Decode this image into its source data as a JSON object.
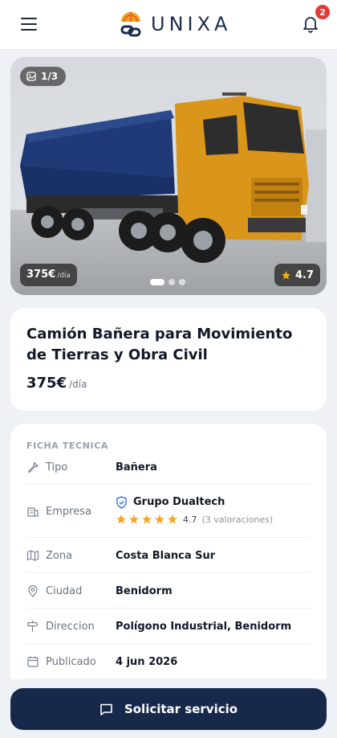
{
  "header": {
    "brand": "UNIXA",
    "notification_count": "2"
  },
  "hero": {
    "image_counter": "1/3",
    "price": "375€",
    "price_unit": "/día",
    "rating": "4.7",
    "slides_total": 3,
    "active_slide": 1
  },
  "listing": {
    "title": "Camión Bañera para Movimiento de Tierras y Obra Civil",
    "price": "375€",
    "price_unit": "/día"
  },
  "spec": {
    "heading": "FICHA TECNICA",
    "tipo": {
      "label": "Tipo",
      "value": "Bañera"
    },
    "empresa": {
      "label": "Empresa",
      "name": "Grupo Dualtech",
      "rating": "4.7",
      "stars": 5,
      "reviews": "(3 valoraciones)"
    },
    "zona": {
      "label": "Zona",
      "value": "Costa Blanca Sur"
    },
    "ciudad": {
      "label": "Ciudad",
      "value": "Benidorm"
    },
    "direccion": {
      "label": "Direccion",
      "value": "Polígono Industrial, Benidorm"
    },
    "publicado": {
      "label": "Publicado",
      "value": "4 jun 2026"
    }
  },
  "cta": {
    "label": "Solicitar servicio"
  },
  "icons": {
    "menu": "hamburger-icon",
    "bell": "bell-icon",
    "image": "image-icon",
    "star": "star-icon",
    "tipo": "wrench-icon",
    "empresa": "building-icon",
    "verified": "shield-check-icon",
    "zona": "map-icon",
    "ciudad": "location-pin-icon",
    "direccion": "signpost-icon",
    "publicado": "calendar-icon",
    "cta": "message-icon"
  },
  "colors": {
    "brand_navy": "#17294a",
    "star": "#f5a623",
    "badge": "#e53935",
    "verified": "#2563eb"
  }
}
